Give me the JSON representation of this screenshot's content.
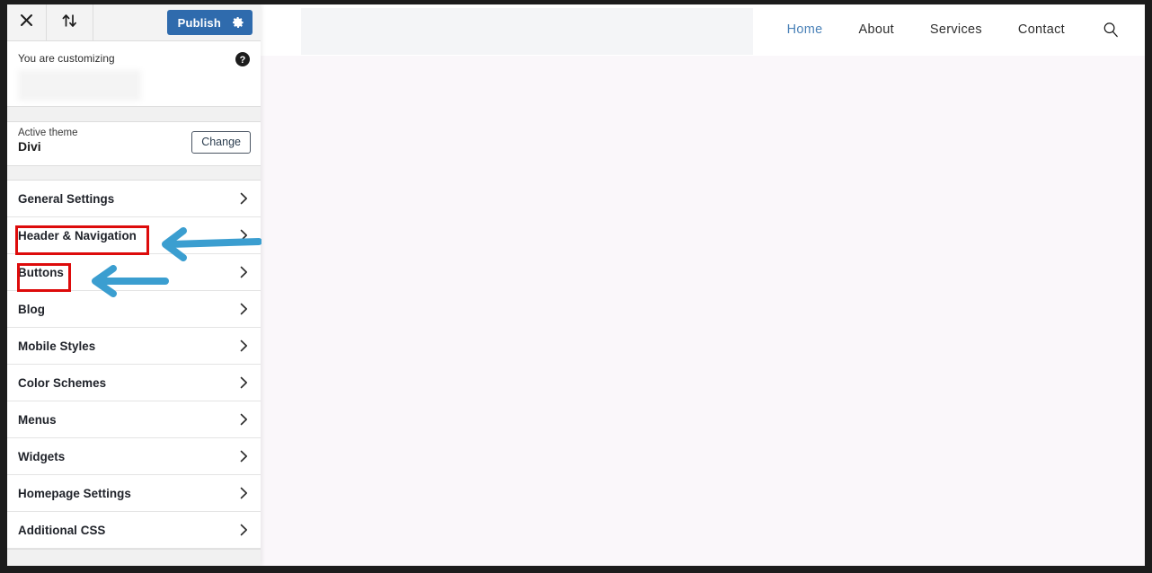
{
  "customizer": {
    "toolbar": {
      "close_icon": "close-x-icon",
      "collapse_icon": "up-down-arrows-icon",
      "publish_label": "Publish",
      "publish_gear_icon": "gear-icon",
      "publish_color": "#2f6bad"
    },
    "info": {
      "customizing_label": "You are customizing",
      "help_icon": "question-mark-circle-icon"
    },
    "theme": {
      "active_theme_label": "Active theme",
      "theme_name": "Divi",
      "change_label": "Change"
    },
    "panels": [
      {
        "label": "General Settings",
        "chevron_icon": "chevron-right-icon"
      },
      {
        "label": "Header & Navigation",
        "chevron_icon": "chevron-right-icon"
      },
      {
        "label": "Buttons",
        "chevron_icon": "chevron-right-icon"
      },
      {
        "label": "Blog",
        "chevron_icon": "chevron-right-icon"
      },
      {
        "label": "Mobile Styles",
        "chevron_icon": "chevron-right-icon"
      },
      {
        "label": "Color Schemes",
        "chevron_icon": "chevron-right-icon"
      },
      {
        "label": "Menus",
        "chevron_icon": "chevron-right-icon"
      },
      {
        "label": "Widgets",
        "chevron_icon": "chevron-right-icon"
      },
      {
        "label": "Homepage Settings",
        "chevron_icon": "chevron-right-icon"
      },
      {
        "label": "Additional CSS",
        "chevron_icon": "chevron-right-icon"
      }
    ]
  },
  "preview": {
    "nav": [
      {
        "label": "Home",
        "active": true
      },
      {
        "label": "About",
        "active": false
      },
      {
        "label": "Services",
        "active": false
      },
      {
        "label": "Contact",
        "active": false
      }
    ],
    "search_icon": "search-magnifier-icon",
    "active_link_color": "#4b82b8",
    "background_color": "#faf7fa"
  },
  "annotations": {
    "highlight_color": "#dd0b0b",
    "arrow_color": "#3b9ed0",
    "boxes": [
      {
        "target": "Header & Navigation"
      },
      {
        "target": "Buttons"
      }
    ],
    "arrows": [
      {
        "points_to": "Header & Navigation",
        "direction": "left"
      },
      {
        "points_to": "Buttons",
        "direction": "left"
      }
    ]
  }
}
